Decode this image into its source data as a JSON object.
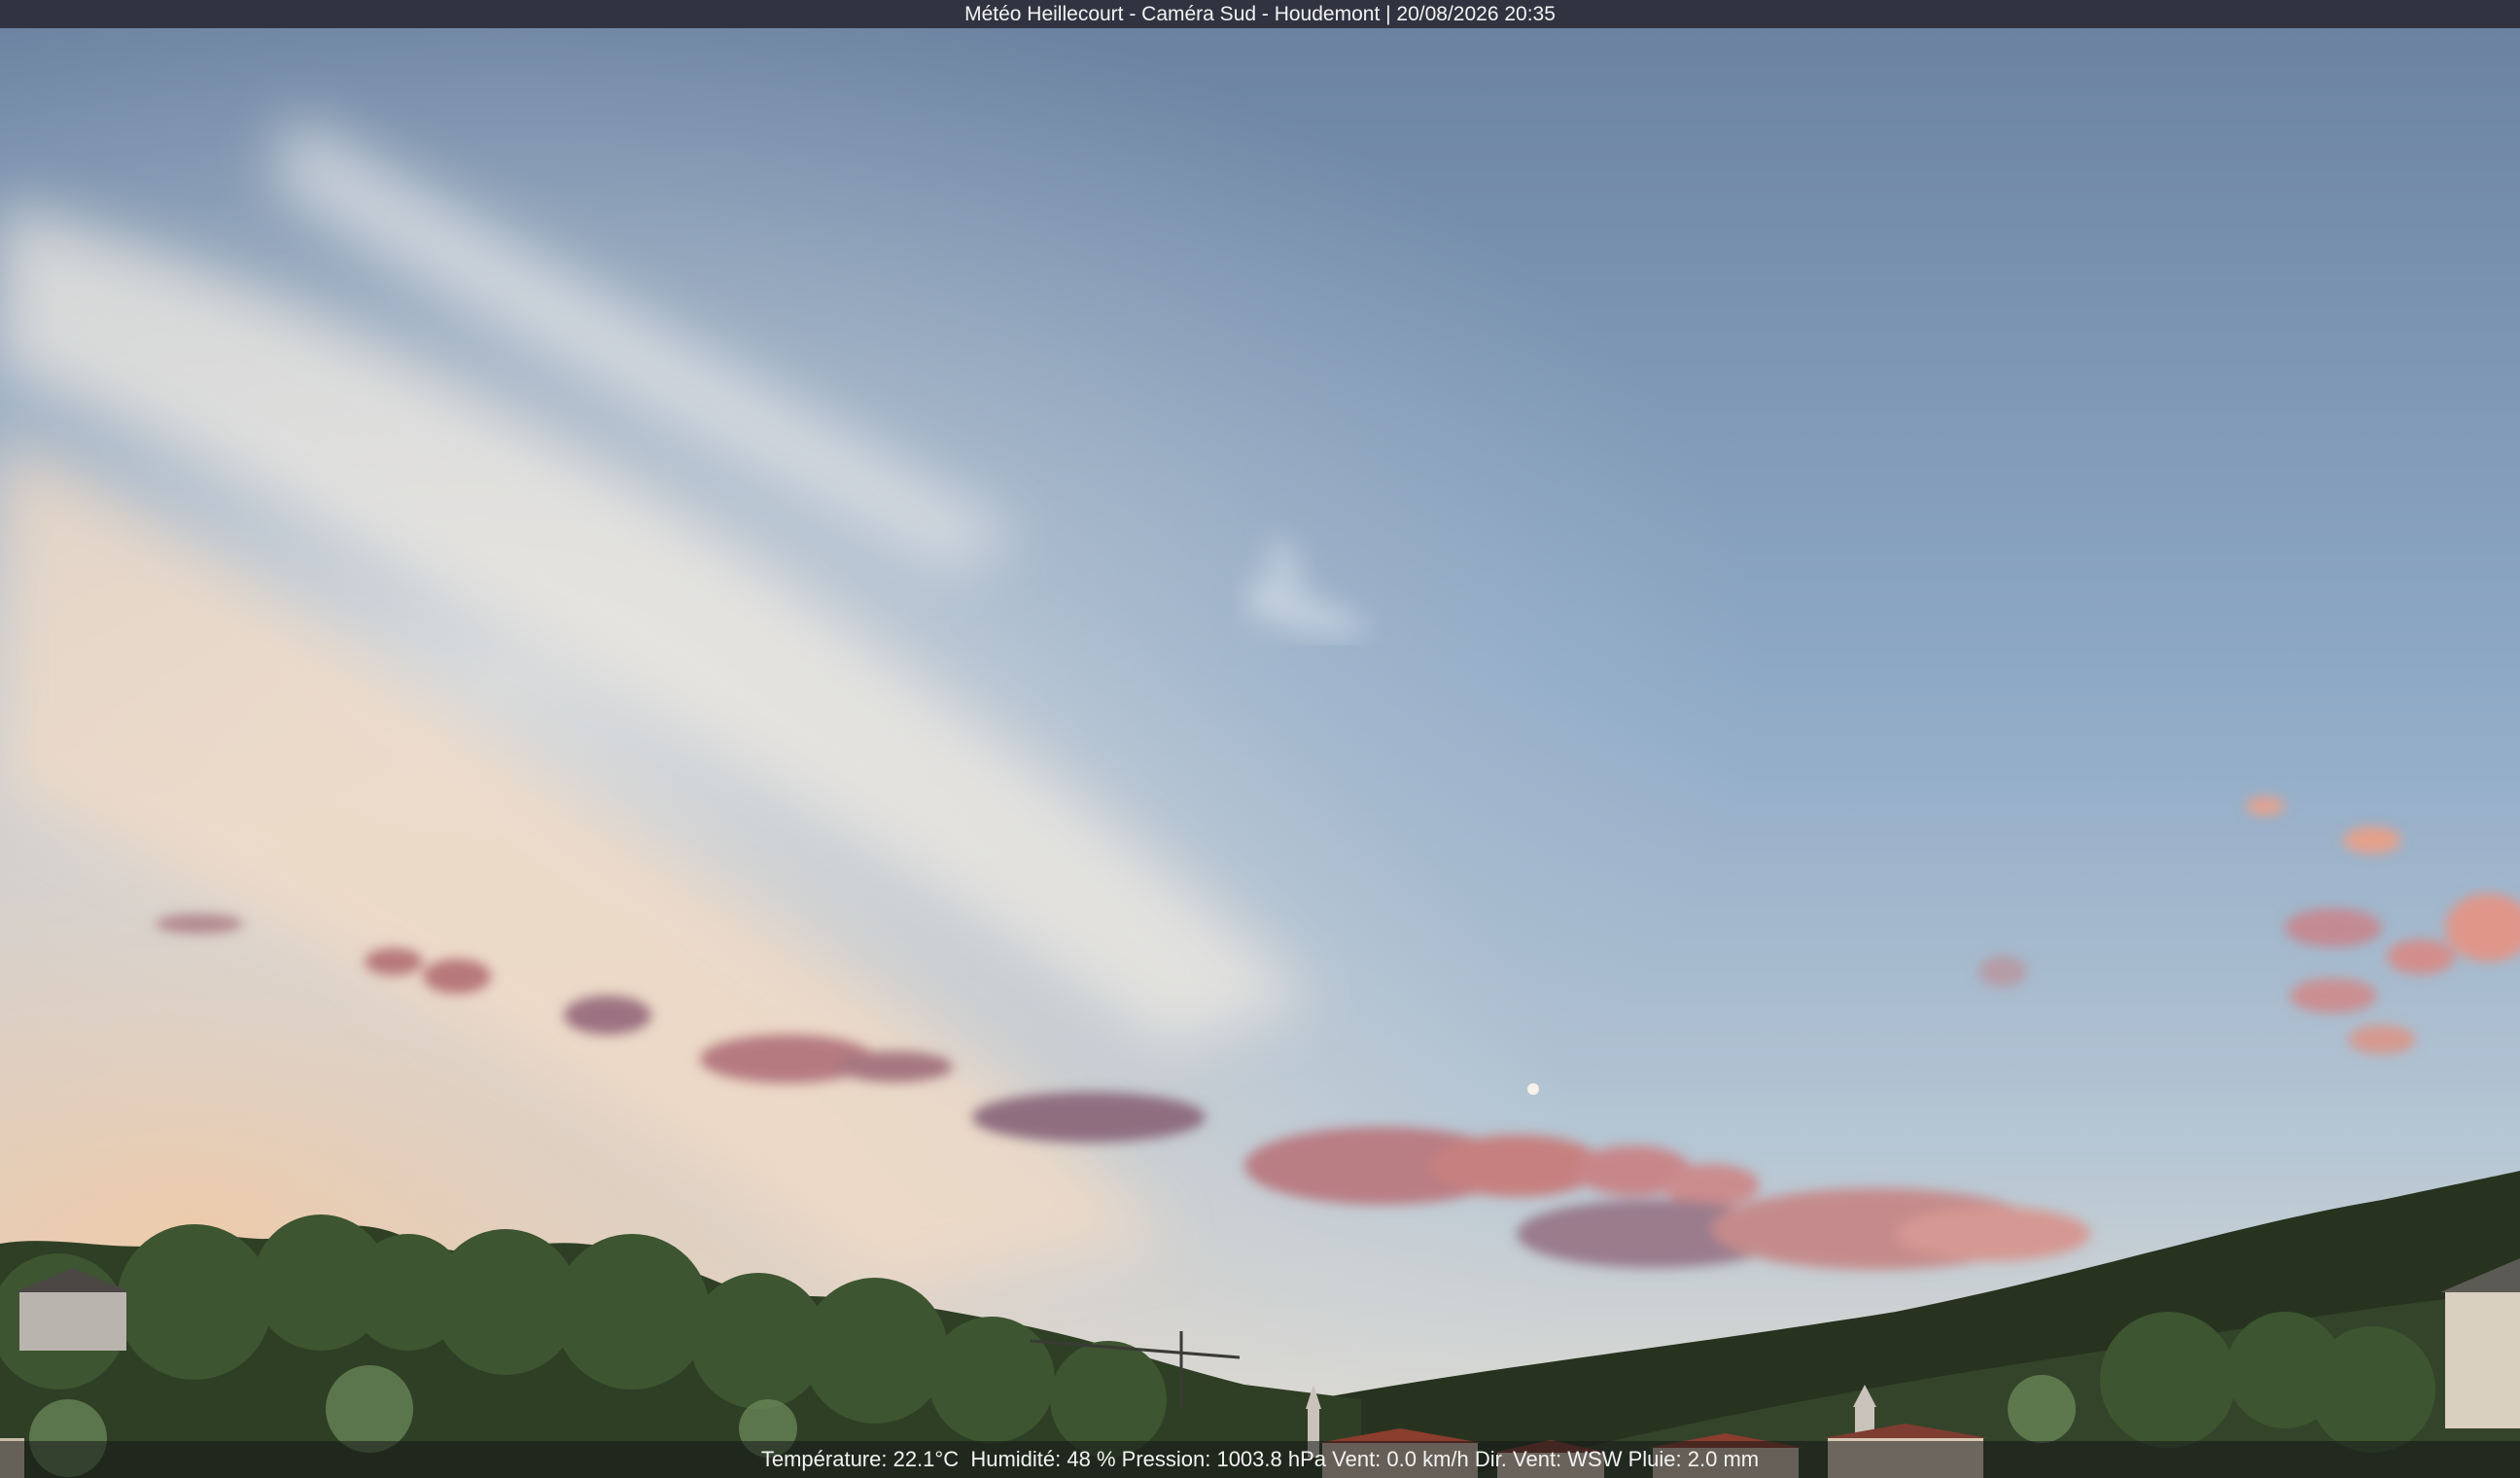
{
  "title_bar": {
    "text": "Météo Heillecourt - Caméra Sud - Houdemont | 20/08/2026 20:35"
  },
  "status_bar": {
    "temperature": "Température: 22.1°C",
    "humidity": "Humidité: 48 %",
    "pressure": "Pression: 1003.8 hPa",
    "wind": "Vent: 0.0 km/h",
    "wind_direction": "Dir. Vent: WSW",
    "rain": "Pluie: 2.0 mm"
  },
  "colors": {
    "sky_top": "#6f86a2",
    "sky_mid": "#93abc6",
    "sky_horizon": "#dcd9d2",
    "cloud_warm": "#f1d7bd",
    "cloud_pink": "#d98a86",
    "hill_dark": "#26331f",
    "tree_green": "#3f5a2c",
    "roof_red": "#8b3d2e"
  }
}
